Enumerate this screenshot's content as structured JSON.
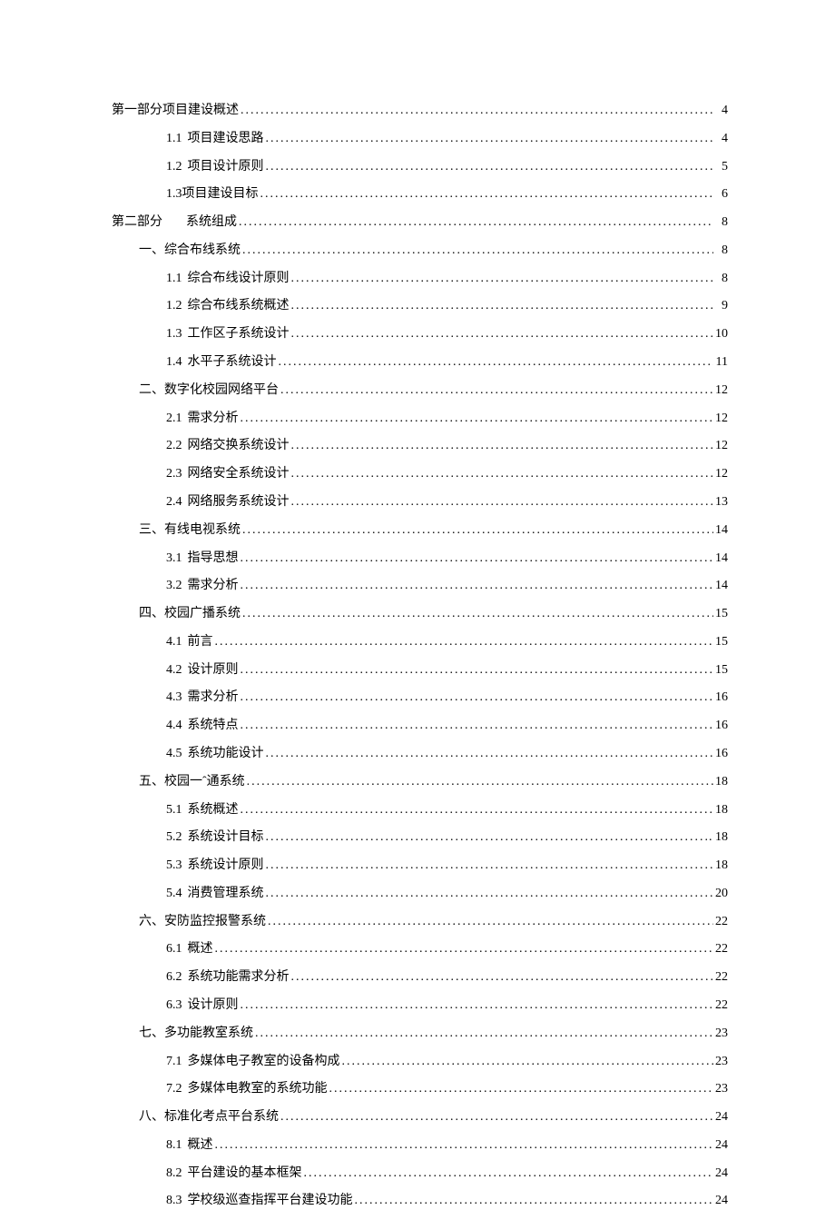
{
  "toc": [
    {
      "level": 0,
      "num": "",
      "title": "第一部分项目建设概述",
      "page": "4",
      "nogap": true
    },
    {
      "level": 2,
      "num": "1.1",
      "title": "项目建设思路",
      "page": "4"
    },
    {
      "level": 2,
      "num": "1.2",
      "title": "项目设计原则",
      "page": "5"
    },
    {
      "level": 2,
      "num": "1.3",
      "title": "项目建设目标",
      "page": "6",
      "tight": true
    },
    {
      "level": 0,
      "num": "",
      "title": "第二部分",
      "title2": "系统组成",
      "page": "8",
      "part2": true
    },
    {
      "level": 1,
      "num": "一、",
      "title": "综合布线系统",
      "page": "8",
      "nogap": true
    },
    {
      "level": 2,
      "num": "1.1",
      "title": "综合布线设计原则",
      "page": "8"
    },
    {
      "level": 2,
      "num": "1.2",
      "title": "综合布线系统概述",
      "page": "9"
    },
    {
      "level": 2,
      "num": "1.3",
      "title": "工作区子系统设计",
      "page": "10"
    },
    {
      "level": 2,
      "num": "1.4",
      "title": "水平子系统设计",
      "page": "11"
    },
    {
      "level": 1,
      "num": "二、",
      "title": "数字化校园网络平台",
      "page": "12",
      "nogap": true
    },
    {
      "level": 2,
      "num": "2.1",
      "title": "需求分析",
      "page": "12"
    },
    {
      "level": 2,
      "num": "2.2",
      "title": "网络交换系统设计",
      "page": "12"
    },
    {
      "level": 2,
      "num": "2.3",
      "title": "网络安全系统设计",
      "page": "12"
    },
    {
      "level": 2,
      "num": "2.4",
      "title": "网络服务系统设计",
      "page": "13"
    },
    {
      "level": 1,
      "num": "三、",
      "title": "有线电视系统",
      "page": "14",
      "nogap": true
    },
    {
      "level": 2,
      "num": "3.1",
      "title": "指导思想",
      "page": "14"
    },
    {
      "level": 2,
      "num": "3.2",
      "title": "需求分析",
      "page": "14"
    },
    {
      "level": 1,
      "num": "四、",
      "title": "校园广播系统",
      "page": "15",
      "nogap": true
    },
    {
      "level": 2,
      "num": "4.1",
      "title": "前言",
      "page": "15"
    },
    {
      "level": 2,
      "num": "4.2",
      "title": "设计原则",
      "page": "15"
    },
    {
      "level": 2,
      "num": "4.3",
      "title": "需求分析",
      "page": "16"
    },
    {
      "level": 2,
      "num": "4.4",
      "title": "系统特点",
      "page": "16"
    },
    {
      "level": 2,
      "num": "4.5",
      "title": "系统功能设计",
      "page": "16"
    },
    {
      "level": 1,
      "num": "五、",
      "title": "校园一ˆ通系统",
      "page": "18",
      "nogap": true
    },
    {
      "level": 2,
      "num": "5.1",
      "title": "系统概述",
      "page": "18"
    },
    {
      "level": 2,
      "num": "5.2",
      "title": "系统设计目标",
      "page": ". 18"
    },
    {
      "level": 2,
      "num": "5.3",
      "title": "系统设计原则",
      "page": "18"
    },
    {
      "level": 2,
      "num": "5.4",
      "title": "消费管理系统",
      "page": "20"
    },
    {
      "level": 1,
      "num": "六、",
      "title": "安防监控报警系统",
      "page": "22",
      "nogap": true
    },
    {
      "level": 2,
      "num": "6.1",
      "title": "概述",
      "page": "22"
    },
    {
      "level": 2,
      "num": "6.2",
      "title": "系统功能需求分析",
      "page": "22"
    },
    {
      "level": 2,
      "num": "6.3",
      "title": "设计原则",
      "page": "22"
    },
    {
      "level": 1,
      "num": "七、",
      "title": "多功能教室系统",
      "page": "23",
      "nogap": true
    },
    {
      "level": 2,
      "num": "7.1",
      "title": "多媒体电子教室的设备构成",
      "page": "23"
    },
    {
      "level": 2,
      "num": "7.2",
      "title": "多媒体电教室的系统功能",
      "page": "23"
    },
    {
      "level": 1,
      "num": "八、",
      "title": "标准化考点平台系统",
      "page": "24",
      "nogap": true
    },
    {
      "level": 2,
      "num": "8.1",
      "title": "概述",
      "page": "24"
    },
    {
      "level": 2,
      "num": "8.2",
      "title": "平台建设的基本框架",
      "page": "24"
    },
    {
      "level": 2,
      "num": "8.3",
      "title": "学校级巡查指挥平台建设功能",
      "page": "24"
    }
  ]
}
